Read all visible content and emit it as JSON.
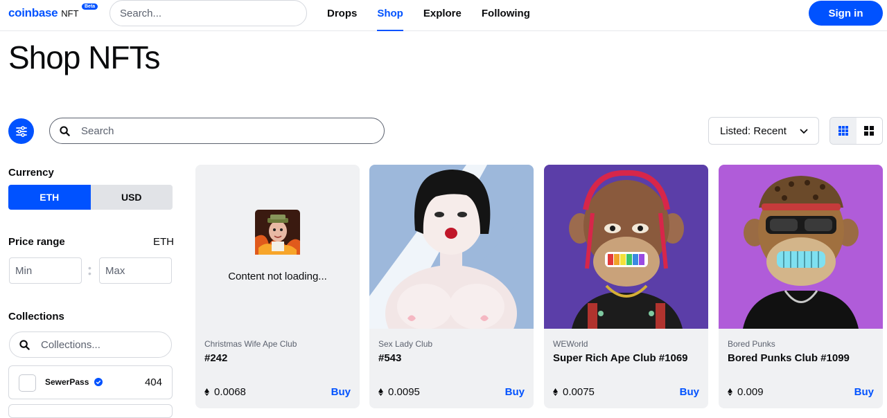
{
  "header": {
    "logo_word": "coinbase",
    "logo_suffix": "NFT",
    "beta_badge": "Beta",
    "search_placeholder": "Search...",
    "nav": [
      {
        "label": "Drops",
        "active": false
      },
      {
        "label": "Shop",
        "active": true
      },
      {
        "label": "Explore",
        "active": false
      },
      {
        "label": "Following",
        "active": false
      }
    ],
    "signin_label": "Sign in"
  },
  "page": {
    "title": "Shop NFTs"
  },
  "toolbar": {
    "filter_icon": "sliders-icon",
    "search_placeholder": "Search",
    "sort_label": "Listed: Recent",
    "view_options": [
      "grid-small-icon",
      "grid-large-icon"
    ],
    "selected_view": "grid-small-icon"
  },
  "sidebar": {
    "currency_heading": "Currency",
    "currency_options": [
      "ETH",
      "USD"
    ],
    "selected_currency": "ETH",
    "price_heading": "Price range",
    "price_unit": "ETH",
    "min_placeholder": "Min",
    "max_placeholder": "Max",
    "collections_heading": "Collections",
    "collections_placeholder": "Collections...",
    "collections": [
      {
        "name": "SewerPass",
        "verified": true,
        "count": "404"
      }
    ]
  },
  "cards": [
    {
      "collection": "Christmas Wife Ape Club",
      "name": "#242",
      "price": "0.0068",
      "buy_label": "Buy",
      "status": "Content not loading..."
    },
    {
      "collection": "Sex Lady Club",
      "name": "#543",
      "price": "0.0095",
      "buy_label": "Buy"
    },
    {
      "collection": "WEWorld",
      "name": "Super Rich Ape Club #1069",
      "price": "0.0075",
      "buy_label": "Buy"
    },
    {
      "collection": "Bored Punks",
      "name": "Bored Punks Club #1099",
      "price": "0.009",
      "buy_label": "Buy"
    }
  ],
  "colors": {
    "brand": "#0052ff",
    "card_bg": "#f0f1f3",
    "card2_bg": "#9db8db",
    "card3_bg": "#5b3ea8",
    "card4_bg": "#b05cd9"
  }
}
